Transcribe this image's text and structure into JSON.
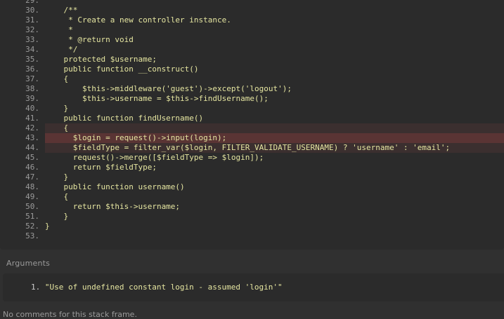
{
  "code": {
    "lines": [
      {
        "num": "29.",
        "text": ""
      },
      {
        "num": "30.",
        "text": "    /**"
      },
      {
        "num": "31.",
        "text": "     * Create a new controller instance."
      },
      {
        "num": "32.",
        "text": "     *"
      },
      {
        "num": "33.",
        "text": "     * @return void"
      },
      {
        "num": "34.",
        "text": "     */"
      },
      {
        "num": "35.",
        "text": "    protected $username;"
      },
      {
        "num": "36.",
        "text": "    public function __construct()"
      },
      {
        "num": "37.",
        "text": "    {"
      },
      {
        "num": "38.",
        "text": "        $this->middleware('guest')->except('logout');"
      },
      {
        "num": "39.",
        "text": "        $this->username = $this->findUsername();"
      },
      {
        "num": "40.",
        "text": "    }"
      },
      {
        "num": "41.",
        "text": "    public function findUsername()"
      },
      {
        "num": "42.",
        "text": "    {"
      },
      {
        "num": "43.",
        "text": "      $login = request()->input(login);"
      },
      {
        "num": "44.",
        "text": "      $fieldType = filter_var($login, FILTER_VALIDATE_USERNAME) ? 'username' : 'email';"
      },
      {
        "num": "45.",
        "text": "      request()->merge([$fieldType => $login]);"
      },
      {
        "num": "46.",
        "text": "      return $fieldType;"
      },
      {
        "num": "47.",
        "text": "    }"
      },
      {
        "num": "48.",
        "text": "    public function username()"
      },
      {
        "num": "49.",
        "text": "    {"
      },
      {
        "num": "50.",
        "text": "      return $this->username;"
      },
      {
        "num": "51.",
        "text": "    }"
      },
      {
        "num": "52.",
        "text": "}"
      },
      {
        "num": "53.",
        "text": ""
      }
    ]
  },
  "arguments": {
    "title": "Arguments",
    "items": [
      {
        "num": "1.",
        "text": "\"Use of undefined constant login - assumed 'login'\""
      }
    ]
  },
  "comments": {
    "note": "No comments for this stack frame."
  },
  "colors": {
    "background": "#303030",
    "panel": "#2b2b2b",
    "code_text": "#e5e5a0",
    "line_number": "#9a9a9a",
    "highlight_soft": "#3b2f2f",
    "highlight_strong": "#5a3434"
  }
}
